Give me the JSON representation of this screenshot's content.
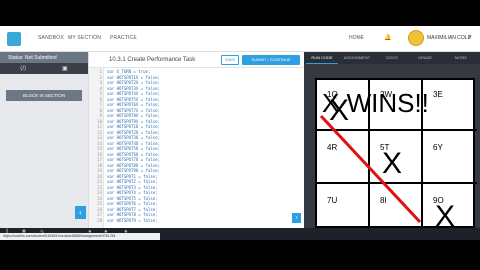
{
  "nav": {
    "links": [
      "SANDBOX",
      "MY SECTION",
      "PRACTICE"
    ],
    "home_label": "HOME",
    "bell_icon": "bell-icon",
    "user_name": "MAXIMILIAN COLE",
    "user_caret_icon": "chevron-down-icon"
  },
  "sidebar": {
    "status": "Status: Not Submitted",
    "icons": [
      "code-icon",
      "calendar-icon"
    ],
    "section_button": "BLOCK IS SECTION"
  },
  "editor": {
    "title": "10.3.1 Create Performance Task",
    "save_label": "SAVE",
    "submit_label": "SUBMIT / CONTINUE",
    "lines": [
      {
        "n": "1",
        "code": "var X_TURN = true;"
      },
      {
        "n": "2",
        "code": "var HOTSPOT1X = false;"
      },
      {
        "n": "3",
        "code": "var HOTSPOT2X = false;"
      },
      {
        "n": "4",
        "code": "var HOTSPOT3X = false;"
      },
      {
        "n": "5",
        "code": "var HOTSPOT4X = false;"
      },
      {
        "n": "6",
        "code": "var HOTSPOT5X = false;"
      },
      {
        "n": "7",
        "code": "var HOTSPOT6X = false;"
      },
      {
        "n": "8",
        "code": "var HOTSPOT7X = false;"
      },
      {
        "n": "9",
        "code": "var HOTSPOT8X = false;"
      },
      {
        "n": "10",
        "code": "var HOTSPOT9X = false;"
      },
      {
        "n": "11",
        "code": "var HOTSPOT1O = false;"
      },
      {
        "n": "12",
        "code": "var HOTSPOT2O = false;"
      },
      {
        "n": "13",
        "code": "var HOTSPOT3O = false;"
      },
      {
        "n": "14",
        "code": "var HOTSPOT4O = false;"
      },
      {
        "n": "15",
        "code": "var HOTSPOT5O = false;"
      },
      {
        "n": "16",
        "code": "var HOTSPOT6O = false;"
      },
      {
        "n": "17",
        "code": "var HOTSPOT7O = false;"
      },
      {
        "n": "18",
        "code": "var HOTSPOT8O = false;"
      },
      {
        "n": "19",
        "code": "var HOTSPOT9O = false;"
      },
      {
        "n": "20",
        "code": "var HOTSPOT1 = false;"
      },
      {
        "n": "21",
        "code": "var HOTSPOT2 = false;"
      },
      {
        "n": "22",
        "code": "var HOTSPOT3 = false;"
      },
      {
        "n": "23",
        "code": "var HOTSPOT4 = false;"
      },
      {
        "n": "24",
        "code": "var HOTSPOT5 = false;"
      },
      {
        "n": "25",
        "code": "var HOTSPOT6 = false;"
      },
      {
        "n": "26",
        "code": "var HOTSPOT7 = false;"
      },
      {
        "n": "27",
        "code": "var HOTSPOT8 = false;"
      },
      {
        "n": "28",
        "code": "var HOTSPOT9 = false;"
      }
    ]
  },
  "panel": {
    "tabs": [
      "RUN CODE",
      "ASSIGNMENT",
      "DOCS",
      "GRADE",
      "MORE"
    ],
    "board": {
      "labels": [
        "1Q",
        "2W",
        "3E",
        "4R",
        "5T",
        "6Y",
        "7U",
        "8I",
        "9O"
      ],
      "marks": [
        "X",
        "",
        "",
        "",
        "X",
        "",
        "",
        "",
        "X"
      ],
      "win_text": "X WINS!!",
      "win_line_color": "#e01010"
    }
  },
  "status_url": "https://codehs.com/student/1169831/section/88689/assignment/3781784"
}
